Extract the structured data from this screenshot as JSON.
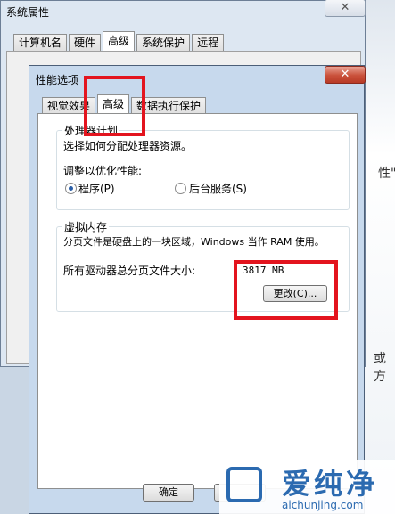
{
  "background": {
    "text_1": "性\"",
    "text_2": "或方"
  },
  "outer_dialog": {
    "title": "系统属性",
    "close": "✕",
    "tabs": [
      "计算机名",
      "硬件",
      "高级",
      "系统保护",
      "远程"
    ]
  },
  "inner_dialog": {
    "title": "性能选项",
    "close": "✕",
    "tabs": [
      "视觉效果",
      "高级",
      "数据执行保护"
    ],
    "processor_group": {
      "title": "处理器计划",
      "description": "选择如何分配处理器资源。",
      "adjust_label": "调整以优化性能:",
      "option_programs": "程序(P)",
      "option_background": "后台服务(S)",
      "selected": "程序(P)"
    },
    "virtual_memory_group": {
      "title": "虚拟内存",
      "description": "分页文件是硬盘上的一块区域，Windows 当作 RAM 使用。",
      "total_label": "所有驱动器总分页文件大小:",
      "total_value": "3817 MB",
      "change_button": "更改(C)..."
    },
    "ok_button": "确定"
  },
  "watermark": {
    "logo_text": "爱纯净",
    "url": "aichunjing.com"
  },
  "colors": {
    "highlight": "#e3141e",
    "accent": "#2b6ab0"
  }
}
